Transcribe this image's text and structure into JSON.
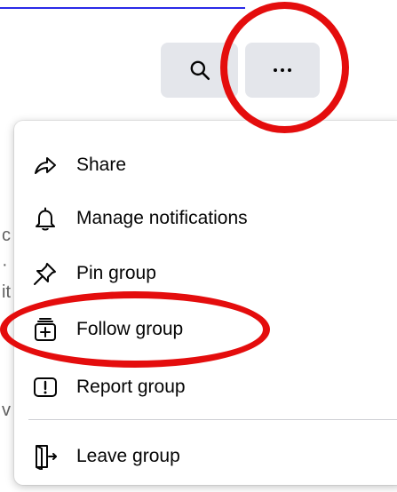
{
  "toolbar": {
    "search_icon": "search-icon",
    "more_icon": "more-horizontal-icon"
  },
  "menu": {
    "items": [
      {
        "label": "Share",
        "icon": "share-icon"
      },
      {
        "label": "Manage notifications",
        "icon": "bell-icon"
      },
      {
        "label": "Pin group",
        "icon": "pin-icon"
      },
      {
        "label": "Follow group",
        "icon": "follow-group-icon"
      },
      {
        "label": "Report group",
        "icon": "report-icon"
      },
      {
        "label": "Leave group",
        "icon": "leave-door-icon"
      }
    ]
  },
  "colors": {
    "annotation": "#e40d0d",
    "button_bg": "#e4e6eb",
    "text": "#050505",
    "divider": "#ced0d4"
  }
}
